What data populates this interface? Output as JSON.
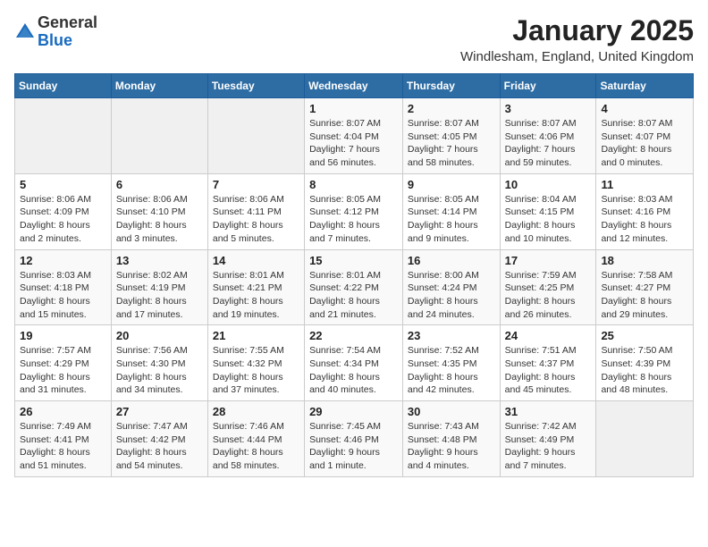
{
  "header": {
    "logo_general": "General",
    "logo_blue": "Blue",
    "month_title": "January 2025",
    "location": "Windlesham, England, United Kingdom"
  },
  "days_of_week": [
    "Sunday",
    "Monday",
    "Tuesday",
    "Wednesday",
    "Thursday",
    "Friday",
    "Saturday"
  ],
  "weeks": [
    [
      {
        "day": "",
        "info": ""
      },
      {
        "day": "",
        "info": ""
      },
      {
        "day": "",
        "info": ""
      },
      {
        "day": "1",
        "info": "Sunrise: 8:07 AM\nSunset: 4:04 PM\nDaylight: 7 hours and 56 minutes."
      },
      {
        "day": "2",
        "info": "Sunrise: 8:07 AM\nSunset: 4:05 PM\nDaylight: 7 hours and 58 minutes."
      },
      {
        "day": "3",
        "info": "Sunrise: 8:07 AM\nSunset: 4:06 PM\nDaylight: 7 hours and 59 minutes."
      },
      {
        "day": "4",
        "info": "Sunrise: 8:07 AM\nSunset: 4:07 PM\nDaylight: 8 hours and 0 minutes."
      }
    ],
    [
      {
        "day": "5",
        "info": "Sunrise: 8:06 AM\nSunset: 4:09 PM\nDaylight: 8 hours and 2 minutes."
      },
      {
        "day": "6",
        "info": "Sunrise: 8:06 AM\nSunset: 4:10 PM\nDaylight: 8 hours and 3 minutes."
      },
      {
        "day": "7",
        "info": "Sunrise: 8:06 AM\nSunset: 4:11 PM\nDaylight: 8 hours and 5 minutes."
      },
      {
        "day": "8",
        "info": "Sunrise: 8:05 AM\nSunset: 4:12 PM\nDaylight: 8 hours and 7 minutes."
      },
      {
        "day": "9",
        "info": "Sunrise: 8:05 AM\nSunset: 4:14 PM\nDaylight: 8 hours and 9 minutes."
      },
      {
        "day": "10",
        "info": "Sunrise: 8:04 AM\nSunset: 4:15 PM\nDaylight: 8 hours and 10 minutes."
      },
      {
        "day": "11",
        "info": "Sunrise: 8:03 AM\nSunset: 4:16 PM\nDaylight: 8 hours and 12 minutes."
      }
    ],
    [
      {
        "day": "12",
        "info": "Sunrise: 8:03 AM\nSunset: 4:18 PM\nDaylight: 8 hours and 15 minutes."
      },
      {
        "day": "13",
        "info": "Sunrise: 8:02 AM\nSunset: 4:19 PM\nDaylight: 8 hours and 17 minutes."
      },
      {
        "day": "14",
        "info": "Sunrise: 8:01 AM\nSunset: 4:21 PM\nDaylight: 8 hours and 19 minutes."
      },
      {
        "day": "15",
        "info": "Sunrise: 8:01 AM\nSunset: 4:22 PM\nDaylight: 8 hours and 21 minutes."
      },
      {
        "day": "16",
        "info": "Sunrise: 8:00 AM\nSunset: 4:24 PM\nDaylight: 8 hours and 24 minutes."
      },
      {
        "day": "17",
        "info": "Sunrise: 7:59 AM\nSunset: 4:25 PM\nDaylight: 8 hours and 26 minutes."
      },
      {
        "day": "18",
        "info": "Sunrise: 7:58 AM\nSunset: 4:27 PM\nDaylight: 8 hours and 29 minutes."
      }
    ],
    [
      {
        "day": "19",
        "info": "Sunrise: 7:57 AM\nSunset: 4:29 PM\nDaylight: 8 hours and 31 minutes."
      },
      {
        "day": "20",
        "info": "Sunrise: 7:56 AM\nSunset: 4:30 PM\nDaylight: 8 hours and 34 minutes."
      },
      {
        "day": "21",
        "info": "Sunrise: 7:55 AM\nSunset: 4:32 PM\nDaylight: 8 hours and 37 minutes."
      },
      {
        "day": "22",
        "info": "Sunrise: 7:54 AM\nSunset: 4:34 PM\nDaylight: 8 hours and 40 minutes."
      },
      {
        "day": "23",
        "info": "Sunrise: 7:52 AM\nSunset: 4:35 PM\nDaylight: 8 hours and 42 minutes."
      },
      {
        "day": "24",
        "info": "Sunrise: 7:51 AM\nSunset: 4:37 PM\nDaylight: 8 hours and 45 minutes."
      },
      {
        "day": "25",
        "info": "Sunrise: 7:50 AM\nSunset: 4:39 PM\nDaylight: 8 hours and 48 minutes."
      }
    ],
    [
      {
        "day": "26",
        "info": "Sunrise: 7:49 AM\nSunset: 4:41 PM\nDaylight: 8 hours and 51 minutes."
      },
      {
        "day": "27",
        "info": "Sunrise: 7:47 AM\nSunset: 4:42 PM\nDaylight: 8 hours and 54 minutes."
      },
      {
        "day": "28",
        "info": "Sunrise: 7:46 AM\nSunset: 4:44 PM\nDaylight: 8 hours and 58 minutes."
      },
      {
        "day": "29",
        "info": "Sunrise: 7:45 AM\nSunset: 4:46 PM\nDaylight: 9 hours and 1 minute."
      },
      {
        "day": "30",
        "info": "Sunrise: 7:43 AM\nSunset: 4:48 PM\nDaylight: 9 hours and 4 minutes."
      },
      {
        "day": "31",
        "info": "Sunrise: 7:42 AM\nSunset: 4:49 PM\nDaylight: 9 hours and 7 minutes."
      },
      {
        "day": "",
        "info": ""
      }
    ]
  ]
}
